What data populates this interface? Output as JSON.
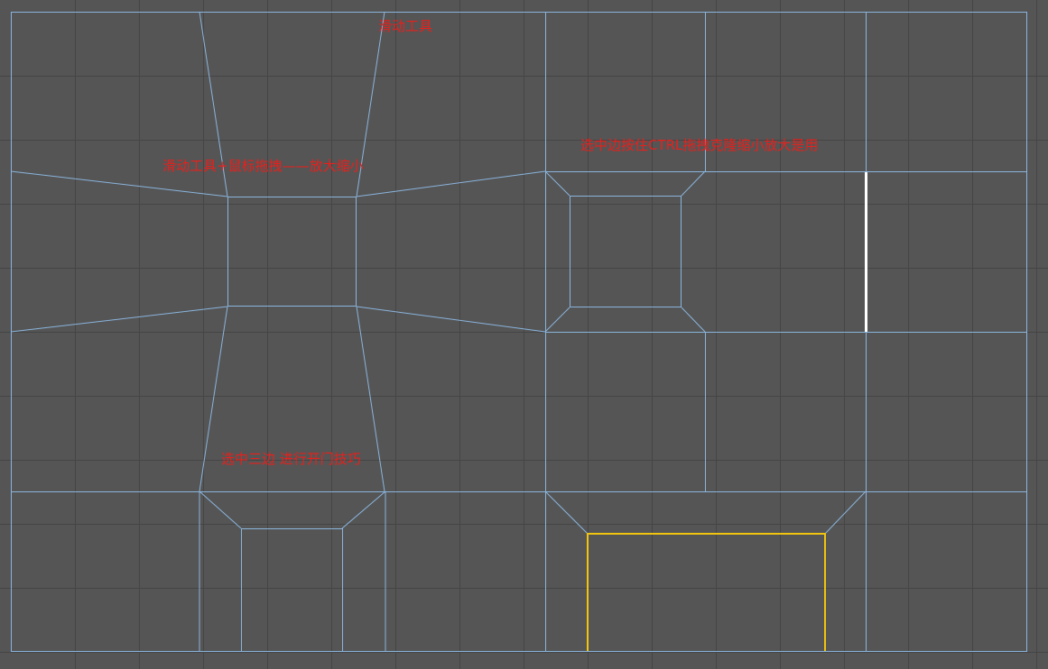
{
  "viewport": {
    "background": "#555555",
    "grid_color": "#444444",
    "wire_color": "#8ab4dc",
    "selected_edge_color": "#ffffff",
    "selected_loop_color": "#f1c40f",
    "note_color": "#e8201c"
  },
  "annotations": {
    "slide_tool": "滑动工具",
    "slide_drag_scale": "滑动工具+鼠标拖拽——放大缩小",
    "ctrl_clone": "选中边按住CTRL拖拽克隆缩小放大是用",
    "three_edges_door": "选中三边 进行开门技巧"
  }
}
